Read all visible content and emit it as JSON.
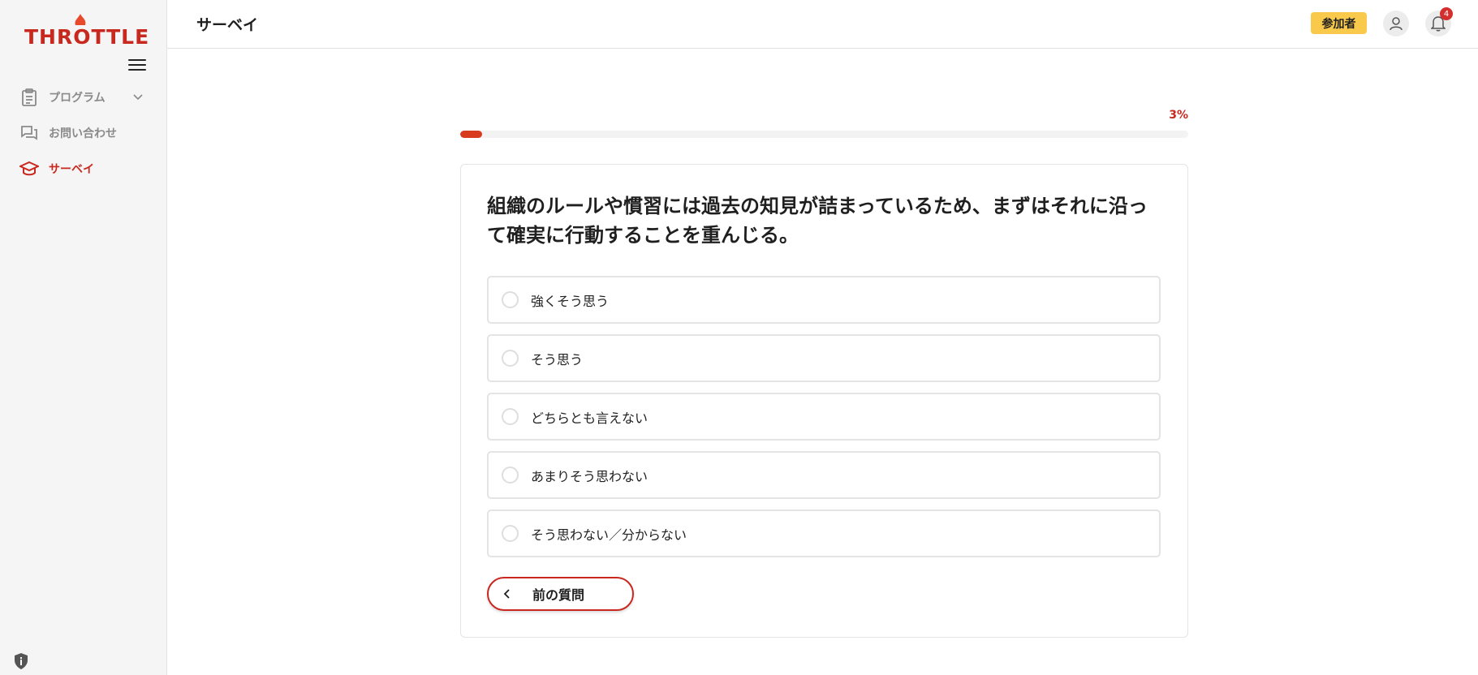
{
  "app": {
    "brand": "THROTTLE",
    "brand_color": "#c8281e"
  },
  "sidebar": {
    "items": [
      {
        "label": "プログラム",
        "icon": "clipboard-icon",
        "active": false
      },
      {
        "label": "お問い合わせ",
        "icon": "chat-icon",
        "active": false
      },
      {
        "label": "サーベイ",
        "icon": "graduation-cap-icon",
        "active": true
      }
    ]
  },
  "header": {
    "title": "サーベイ",
    "role_badge": "参加者",
    "notification_count": "4"
  },
  "survey": {
    "progress_label": "3%",
    "progress_value": 3,
    "question": "組織のルールや慣習には過去の知見が詰まっているため、まずはそれに沿って確実に行動することを重んじる。",
    "options": [
      "強くそう思う",
      "そう思う",
      "どちらとも言えない",
      "あまりそう思わない",
      "そう思わない／分からない"
    ],
    "prev_button": "前の質問"
  },
  "colors": {
    "accent": "#c8281e",
    "progress": "#d83a1e",
    "badge": "#f8c94a"
  }
}
